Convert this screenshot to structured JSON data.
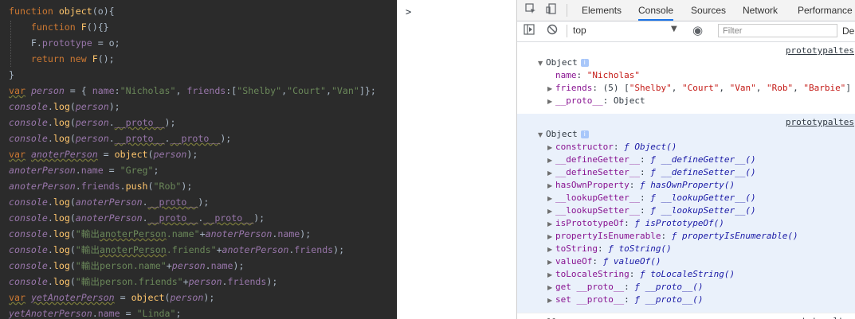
{
  "editor": {
    "lines": [
      [
        {
          "t": "function ",
          "c": "t-kw"
        },
        {
          "t": "object",
          "c": "t-fn"
        },
        {
          "t": "(o){",
          "c": "t-pl"
        }
      ],
      [
        {
          "t": "    function ",
          "c": "t-kw"
        },
        {
          "t": "F",
          "c": "t-fn"
        },
        {
          "t": "(){}",
          "c": "t-pl"
        }
      ],
      [
        {
          "t": "    F.",
          "c": "t-pl"
        },
        {
          "t": "prototype",
          "c": "t-prop"
        },
        {
          "t": " = o;",
          "c": "t-pl"
        }
      ],
      [
        {
          "t": "    return new ",
          "c": "t-kw"
        },
        {
          "t": "F",
          "c": "t-fn"
        },
        {
          "t": "();",
          "c": "t-pl"
        }
      ],
      [
        {
          "t": "}",
          "c": "t-pl"
        }
      ],
      [
        {
          "t": "var",
          "c": "t-kw t-sq"
        },
        {
          "t": " ",
          "c": "t-pl"
        },
        {
          "t": "person",
          "c": "t-var"
        },
        {
          "t": " = { ",
          "c": "t-pl"
        },
        {
          "t": "name",
          "c": "t-prop"
        },
        {
          "t": ":",
          "c": "t-pl"
        },
        {
          "t": "\"Nicholas\"",
          "c": "t-str"
        },
        {
          "t": ", ",
          "c": "t-pl"
        },
        {
          "t": "friends",
          "c": "t-prop"
        },
        {
          "t": ":[",
          "c": "t-pl"
        },
        {
          "t": "\"Shelby\"",
          "c": "t-str"
        },
        {
          "t": ",",
          "c": "t-pl"
        },
        {
          "t": "\"Court\"",
          "c": "t-str"
        },
        {
          "t": ",",
          "c": "t-pl"
        },
        {
          "t": "\"Van\"",
          "c": "t-str"
        },
        {
          "t": "]};",
          "c": "t-pl"
        }
      ],
      [
        {
          "t": "console",
          "c": "t-var"
        },
        {
          "t": ".",
          "c": "t-pl"
        },
        {
          "t": "log",
          "c": "t-fn"
        },
        {
          "t": "(",
          "c": "t-pl"
        },
        {
          "t": "person",
          "c": "t-var"
        },
        {
          "t": ");",
          "c": "t-pl"
        }
      ],
      [
        {
          "t": "console",
          "c": "t-var"
        },
        {
          "t": ".",
          "c": "t-pl"
        },
        {
          "t": "log",
          "c": "t-fn"
        },
        {
          "t": "(",
          "c": "t-pl"
        },
        {
          "t": "person",
          "c": "t-var"
        },
        {
          "t": ".",
          "c": "t-pl"
        },
        {
          "t": "__proto__",
          "c": "t-prop t-sq"
        },
        {
          "t": ");",
          "c": "t-pl"
        }
      ],
      [
        {
          "t": "console",
          "c": "t-var"
        },
        {
          "t": ".",
          "c": "t-pl"
        },
        {
          "t": "log",
          "c": "t-fn"
        },
        {
          "t": "(",
          "c": "t-pl"
        },
        {
          "t": "person",
          "c": "t-var"
        },
        {
          "t": ".",
          "c": "t-pl"
        },
        {
          "t": "__proto__",
          "c": "t-prop t-sq"
        },
        {
          "t": ".",
          "c": "t-pl"
        },
        {
          "t": "__proto__",
          "c": "t-prop t-sq"
        },
        {
          "t": ");",
          "c": "t-pl"
        }
      ],
      [
        {
          "t": "var",
          "c": "t-kw t-sq"
        },
        {
          "t": " ",
          "c": "t-pl"
        },
        {
          "t": "anoterPerson",
          "c": "t-var t-sq"
        },
        {
          "t": " = ",
          "c": "t-pl"
        },
        {
          "t": "object",
          "c": "t-fn"
        },
        {
          "t": "(",
          "c": "t-pl"
        },
        {
          "t": "person",
          "c": "t-var"
        },
        {
          "t": ");",
          "c": "t-pl"
        }
      ],
      [
        {
          "t": "anoterPerson",
          "c": "t-var"
        },
        {
          "t": ".",
          "c": "t-pl"
        },
        {
          "t": "name",
          "c": "t-prop"
        },
        {
          "t": " = ",
          "c": "t-pl"
        },
        {
          "t": "\"Greg\"",
          "c": "t-str"
        },
        {
          "t": ";",
          "c": "t-pl"
        }
      ],
      [
        {
          "t": "anoterPerson",
          "c": "t-var"
        },
        {
          "t": ".",
          "c": "t-pl"
        },
        {
          "t": "friends",
          "c": "t-prop"
        },
        {
          "t": ".",
          "c": "t-pl"
        },
        {
          "t": "push",
          "c": "t-fn"
        },
        {
          "t": "(",
          "c": "t-pl"
        },
        {
          "t": "\"Rob\"",
          "c": "t-str"
        },
        {
          "t": ");",
          "c": "t-pl"
        }
      ],
      [
        {
          "t": "console",
          "c": "t-var"
        },
        {
          "t": ".",
          "c": "t-pl"
        },
        {
          "t": "log",
          "c": "t-fn"
        },
        {
          "t": "(",
          "c": "t-pl"
        },
        {
          "t": "anoterPerson",
          "c": "t-var"
        },
        {
          "t": ".",
          "c": "t-pl"
        },
        {
          "t": "__proto__",
          "c": "t-prop t-sq"
        },
        {
          "t": ");",
          "c": "t-pl"
        }
      ],
      [
        {
          "t": "console",
          "c": "t-var"
        },
        {
          "t": ".",
          "c": "t-pl"
        },
        {
          "t": "log",
          "c": "t-fn"
        },
        {
          "t": "(",
          "c": "t-pl"
        },
        {
          "t": "anoterPerson",
          "c": "t-var"
        },
        {
          "t": ".",
          "c": "t-pl"
        },
        {
          "t": "__proto__",
          "c": "t-prop t-sq"
        },
        {
          "t": ".",
          "c": "t-pl"
        },
        {
          "t": "__proto__",
          "c": "t-prop t-sq"
        },
        {
          "t": ");",
          "c": "t-pl"
        }
      ],
      [
        {
          "t": "console",
          "c": "t-var"
        },
        {
          "t": ".",
          "c": "t-pl"
        },
        {
          "t": "log",
          "c": "t-fn"
        },
        {
          "t": "(",
          "c": "t-pl"
        },
        {
          "t": "\"輸出",
          "c": "t-str"
        },
        {
          "t": "anoterPerson",
          "c": "t-str t-sq"
        },
        {
          "t": ".name\"",
          "c": "t-str"
        },
        {
          "t": "+",
          "c": "t-pl"
        },
        {
          "t": "anoterPerson",
          "c": "t-var"
        },
        {
          "t": ".",
          "c": "t-pl"
        },
        {
          "t": "name",
          "c": "t-prop"
        },
        {
          "t": ");",
          "c": "t-pl"
        }
      ],
      [
        {
          "t": "console",
          "c": "t-var"
        },
        {
          "t": ".",
          "c": "t-pl"
        },
        {
          "t": "log",
          "c": "t-fn"
        },
        {
          "t": "(",
          "c": "t-pl"
        },
        {
          "t": "\"輸出",
          "c": "t-str"
        },
        {
          "t": "anoterPerson",
          "c": "t-str t-sq"
        },
        {
          "t": ".friends\"",
          "c": "t-str"
        },
        {
          "t": "+",
          "c": "t-pl"
        },
        {
          "t": "anoterPerson",
          "c": "t-var"
        },
        {
          "t": ".",
          "c": "t-pl"
        },
        {
          "t": "friends",
          "c": "t-prop"
        },
        {
          "t": ");",
          "c": "t-pl"
        }
      ],
      [
        {
          "t": "console",
          "c": "t-var"
        },
        {
          "t": ".",
          "c": "t-pl"
        },
        {
          "t": "log",
          "c": "t-fn"
        },
        {
          "t": "(",
          "c": "t-pl"
        },
        {
          "t": "\"輸出person.name\"",
          "c": "t-str"
        },
        {
          "t": "+",
          "c": "t-pl"
        },
        {
          "t": "person",
          "c": "t-var"
        },
        {
          "t": ".",
          "c": "t-pl"
        },
        {
          "t": "name",
          "c": "t-prop"
        },
        {
          "t": ");",
          "c": "t-pl"
        }
      ],
      [
        {
          "t": "console",
          "c": "t-var"
        },
        {
          "t": ".",
          "c": "t-pl"
        },
        {
          "t": "log",
          "c": "t-fn"
        },
        {
          "t": "(",
          "c": "t-pl"
        },
        {
          "t": "\"輸出person.friends\"",
          "c": "t-str"
        },
        {
          "t": "+",
          "c": "t-pl"
        },
        {
          "t": "person",
          "c": "t-var"
        },
        {
          "t": ".",
          "c": "t-pl"
        },
        {
          "t": "friends",
          "c": "t-prop"
        },
        {
          "t": ");",
          "c": "t-pl"
        }
      ],
      [
        {
          "t": "var",
          "c": "t-kw t-sq"
        },
        {
          "t": " ",
          "c": "t-pl"
        },
        {
          "t": "yetAnoterPerson",
          "c": "t-var t-sq"
        },
        {
          "t": " = ",
          "c": "t-pl"
        },
        {
          "t": "object",
          "c": "t-fn"
        },
        {
          "t": "(",
          "c": "t-pl"
        },
        {
          "t": "person",
          "c": "t-var"
        },
        {
          "t": ");",
          "c": "t-pl"
        }
      ],
      [
        {
          "t": "yetAnoterPerson",
          "c": "t-var"
        },
        {
          "t": ".",
          "c": "t-pl"
        },
        {
          "t": "name",
          "c": "t-prop"
        },
        {
          "t": " = ",
          "c": "t-pl"
        },
        {
          "t": "\"Linda\"",
          "c": "t-str"
        },
        {
          "t": ";",
          "c": "t-pl"
        }
      ]
    ]
  },
  "console_prompt": ">",
  "devtools": {
    "tabs": [
      "Elements",
      "Console",
      "Sources",
      "Network",
      "Performance"
    ],
    "active_tab": "Console",
    "context": "top",
    "filter_placeholder": "Filter",
    "levels_label": "De",
    "icons": {
      "inspect": "inspect-icon",
      "device": "device-toggle-icon",
      "sidebar": "sidebar-toggle-icon",
      "clear": "clear-console-icon",
      "eye": "live-expression-icon"
    },
    "messages": [
      {
        "source": "prototypaltes",
        "header": "Object",
        "rows": [
          {
            "arrow": "",
            "key": "name",
            "sep": ": ",
            "value": "\"Nicholas\"",
            "vclass": "k-str"
          },
          {
            "arrow": "▶",
            "key": "friends",
            "sep": ": ",
            "value": "(5) [\"Shelby\", \"Court\", \"Van\", \"Rob\", \"Barbie\"]",
            "vclass": "k-cls"
          },
          {
            "arrow": "▶",
            "key": "__proto__",
            "sep": ": ",
            "value": "Object",
            "vclass": "k-cls"
          }
        ]
      },
      {
        "source": "prototypaltes",
        "header": "Object",
        "rows": [
          {
            "arrow": "▶",
            "key": "constructor",
            "sep": ": ",
            "value": "ƒ Object()",
            "vclass": "k-fn"
          },
          {
            "arrow": "▶",
            "key": "__defineGetter__",
            "sep": ": ",
            "value": "ƒ __defineGetter__()",
            "vclass": "k-fn"
          },
          {
            "arrow": "▶",
            "key": "__defineSetter__",
            "sep": ": ",
            "value": "ƒ __defineSetter__()",
            "vclass": "k-fn"
          },
          {
            "arrow": "▶",
            "key": "hasOwnProperty",
            "sep": ": ",
            "value": "ƒ hasOwnProperty()",
            "vclass": "k-fn"
          },
          {
            "arrow": "▶",
            "key": "__lookupGetter__",
            "sep": ": ",
            "value": "ƒ __lookupGetter__()",
            "vclass": "k-fn"
          },
          {
            "arrow": "▶",
            "key": "__lookupSetter__",
            "sep": ": ",
            "value": "ƒ __lookupSetter__()",
            "vclass": "k-fn"
          },
          {
            "arrow": "▶",
            "key": "isPrototypeOf",
            "sep": ": ",
            "value": "ƒ isPrototypeOf()",
            "vclass": "k-fn"
          },
          {
            "arrow": "▶",
            "key": "propertyIsEnumerable",
            "sep": ": ",
            "value": "ƒ propertyIsEnumerable()",
            "vclass": "k-fn"
          },
          {
            "arrow": "▶",
            "key": "toString",
            "sep": ": ",
            "value": "ƒ toString()",
            "vclass": "k-fn"
          },
          {
            "arrow": "▶",
            "key": "valueOf",
            "sep": ": ",
            "value": "ƒ valueOf()",
            "vclass": "k-fn"
          },
          {
            "arrow": "▶",
            "key": "toLocaleString",
            "sep": ": ",
            "value": "ƒ toLocaleString()",
            "vclass": "k-fn"
          },
          {
            "arrow": "▶",
            "key": "get __proto__",
            "sep": ": ",
            "value": "ƒ __proto__()",
            "vclass": "k-fn"
          },
          {
            "arrow": "▶",
            "key": "set __proto__",
            "sep": ": ",
            "value": "ƒ __proto__()",
            "vclass": "k-fn"
          }
        ]
      },
      {
        "source": "prototypaltes",
        "value": "null"
      }
    ]
  }
}
